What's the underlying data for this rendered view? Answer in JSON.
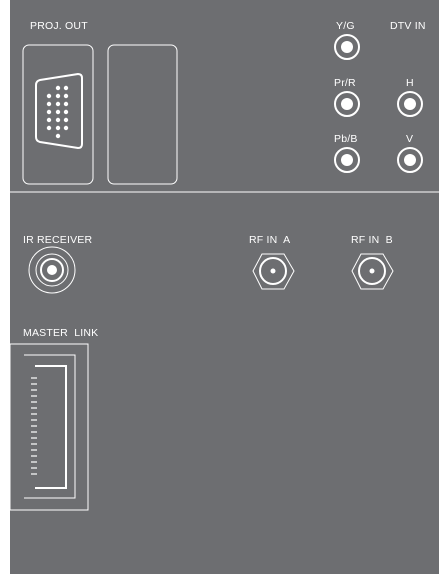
{
  "colors": {
    "panel": "#6d6e71",
    "line": "#ffffff",
    "page": "#ffffff"
  },
  "labels": {
    "proj_out": "PROJ. OUT",
    "y_g": "Y/G",
    "dtv_in": "DTV IN",
    "pr_r": "Pr/R",
    "h": "H",
    "pb_b": "Pb/B",
    "v": "V",
    "ir_receiver": "IR RECEIVER",
    "rf_in_a": "RF IN  A",
    "rf_in_b": "RF IN  B",
    "master_link": "MASTER  LINK"
  },
  "icons": {
    "vga": "vga-connector-icon",
    "blank": "blank-port-cover-icon",
    "rca": "rca-jack-icon",
    "ir": "ir-receiver-icon",
    "rf": "rf-coax-connector-icon",
    "ml": "master-link-connector-icon"
  }
}
